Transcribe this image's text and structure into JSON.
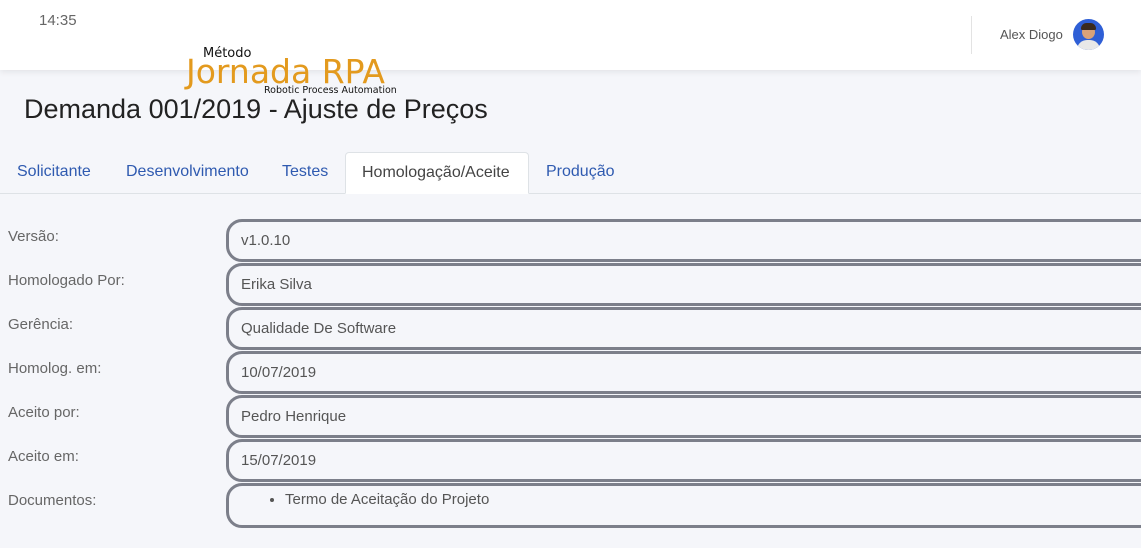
{
  "header": {
    "time": "14:35",
    "user_name": "Alex Diogo"
  },
  "logo": {
    "top_text": "Método",
    "main_text": "Jornada RPA",
    "sub_text": "Robotic Process Automation",
    "color": "#e39a1e"
  },
  "page": {
    "title": "Demanda 001/2019 - Ajuste de Preços"
  },
  "tabs": [
    {
      "label": "Solicitante",
      "active": false
    },
    {
      "label": "Desenvolvimento",
      "active": false
    },
    {
      "label": "Testes",
      "active": false
    },
    {
      "label": "Homologação/Aceite",
      "active": true
    },
    {
      "label": "Produção",
      "active": false
    }
  ],
  "form": {
    "versao": {
      "label": "Versão:",
      "value": "v1.0.10"
    },
    "homologado_por": {
      "label": "Homologado Por:",
      "value": "Erika Silva"
    },
    "gerencia": {
      "label": "Gerência:",
      "value": "Qualidade De Software"
    },
    "homolog_em": {
      "label": "Homolog. em:",
      "value": "10/07/2019"
    },
    "aceito_por": {
      "label": "Aceito por:",
      "value": "Pedro Henrique"
    },
    "aceito_em": {
      "label": "Aceito em:",
      "value": "15/07/2019"
    },
    "documentos": {
      "label": "Documentos:",
      "items": [
        "Termo de Aceitação do Projeto"
      ]
    }
  },
  "colors": {
    "link": "#2f5ab0",
    "field_border": "#7c7f8a",
    "background": "#f5f6fa"
  }
}
